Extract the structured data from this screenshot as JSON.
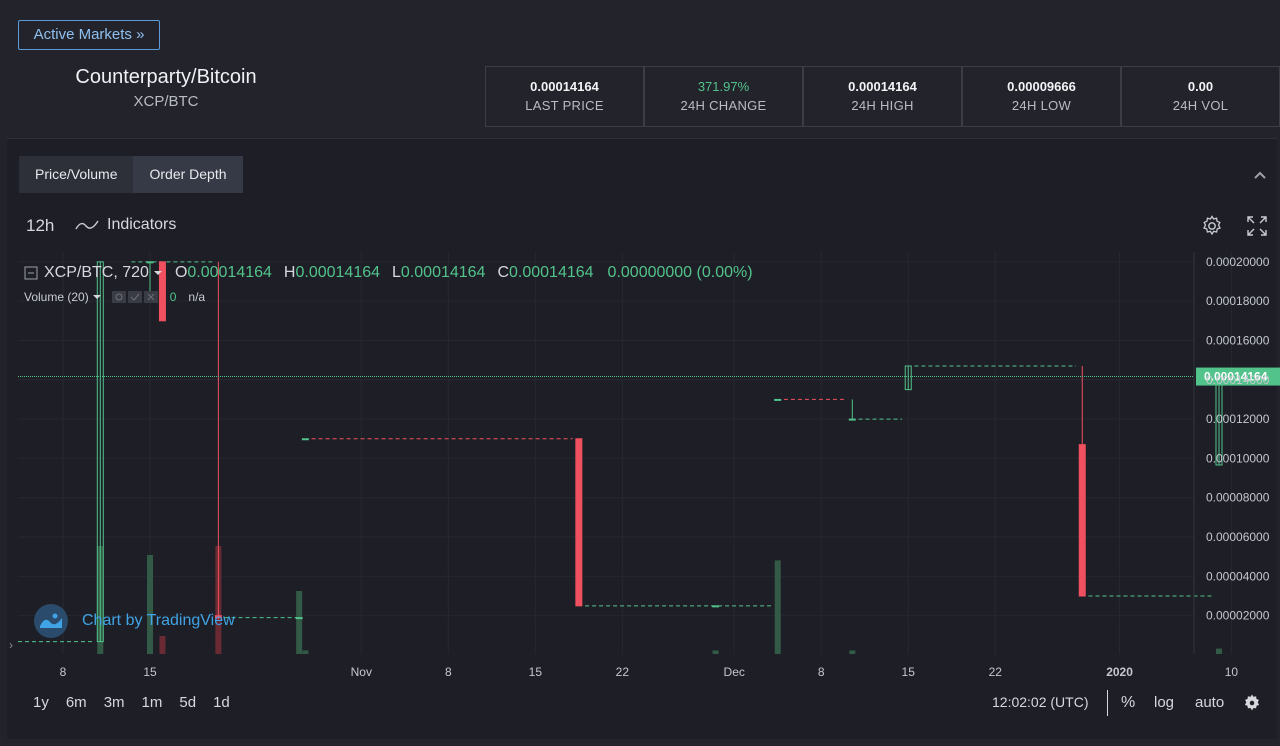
{
  "header": {
    "active_markets_label": "Active Markets »",
    "pair_name": "Counterparty/Bitcoin",
    "pair_symbol": "XCP/BTC"
  },
  "stats": [
    {
      "value": "0.00014164",
      "label": "LAST PRICE"
    },
    {
      "value": "371.97%",
      "label": "24H CHANGE"
    },
    {
      "value": "0.00014164",
      "label": "24H HIGH"
    },
    {
      "value": "0.00009666",
      "label": "24H LOW"
    },
    {
      "value": "0.00",
      "label": "24H VOL"
    }
  ],
  "tabs": [
    {
      "label": "Price/Volume"
    },
    {
      "label": "Order Depth"
    }
  ],
  "toolbar": {
    "interval": "12h",
    "indicators_label": "Indicators"
  },
  "legend": {
    "symbol": "XCP/BTC, 720",
    "o_label": "O",
    "o_value": "0.00014164",
    "h_label": "H",
    "h_value": "0.00014164",
    "l_label": "L",
    "l_value": "0.00014164",
    "c_label": "C",
    "c_value": "0.00014164",
    "change": "0.00000000 (0.00%)",
    "volume_label": "Volume (20)",
    "volume_value": "0",
    "volume_na": "n/a"
  },
  "watermark": "Chart by TradingView",
  "bottom": {
    "ranges": [
      "1y",
      "6m",
      "3m",
      "1m",
      "5d",
      "1d"
    ],
    "time": "12:02:02 (UTC)",
    "percent": "%",
    "log": "log",
    "auto": "auto"
  },
  "colors": {
    "up": "#52c38b",
    "down": "#f0505f",
    "up_volume": "#335a46",
    "down_volume": "#6a2a33"
  },
  "chart_data": {
    "type": "candlestick",
    "y_ticks": [
      "0.00020000",
      "0.00018000",
      "0.00016000",
      "0.00014000",
      "0.00012000",
      "0.00010000",
      "0.00008000",
      "0.00006000",
      "0.00004000",
      "0.00002000"
    ],
    "ylim": [
      5e-07,
      0.000205
    ],
    "x_ticks": [
      {
        "label": "8",
        "day": 8
      },
      {
        "label": "15",
        "day": 15
      },
      {
        "label": "Nov",
        "day": 32
      },
      {
        "label": "8",
        "day": 39
      },
      {
        "label": "15",
        "day": 46
      },
      {
        "label": "22",
        "day": 53
      },
      {
        "label": "Dec",
        "day": 62
      },
      {
        "label": "8",
        "day": 69
      },
      {
        "label": "15",
        "day": 76
      },
      {
        "label": "22",
        "day": 83
      },
      {
        "label": "2020",
        "day": 93
      },
      {
        "label": "10",
        "day": 102
      }
    ],
    "last_price": 0.00014164,
    "last_price_label": "0.00014164",
    "candles": [
      {
        "day": 11.0,
        "open": 6.8e-06,
        "close": 0.0002,
        "high": 0.0002,
        "low": 6.8e-06,
        "volume": 0.6
      },
      {
        "day": 15.0,
        "open": 0.0002,
        "close": 0.0002,
        "high": 0.0002,
        "low": 0.00018,
        "volume": 0.55
      },
      {
        "day": 16.0,
        "open": 0.0002,
        "close": 0.00017,
        "high": 0.0002,
        "low": 0.00017,
        "volume": 0.1
      },
      {
        "day": 20.5,
        "open": 2e-05,
        "close": 1.9e-05,
        "high": 0.0002,
        "low": 1.8e-05,
        "volume": 0.6
      },
      {
        "day": 27.0,
        "open": 1.9e-05,
        "close": 1.9e-05,
        "high": 1.9e-05,
        "low": 1.9e-05,
        "volume": 0.35
      },
      {
        "day": 27.5,
        "open": 0.00011,
        "close": 0.00011,
        "high": 0.00011,
        "low": 0.00011,
        "volume": 0.02
      },
      {
        "day": 49.5,
        "open": 0.00011,
        "close": 2.5e-05,
        "high": 0.00011,
        "low": 2.5e-05,
        "volume": 0.0
      },
      {
        "day": 60.5,
        "open": 2.5e-05,
        "close": 2.5e-05,
        "high": 2.5e-05,
        "low": 2.5e-05,
        "volume": 0.02
      },
      {
        "day": 65.5,
        "open": 0.00013,
        "close": 0.00013,
        "high": 0.00013,
        "low": 0.00013,
        "volume": 0.52
      },
      {
        "day": 71.5,
        "open": 0.00012,
        "close": 0.00012,
        "high": 0.00013,
        "low": 0.00012,
        "volume": 0.02
      },
      {
        "day": 76.0,
        "open": 0.000135,
        "close": 0.000147,
        "high": 0.000147,
        "low": 0.000135,
        "volume": 0.0
      },
      {
        "day": 90.0,
        "open": 0.000107,
        "close": 3e-05,
        "high": 0.000147,
        "low": 3e-05,
        "volume": 0.0
      },
      {
        "day": 101.0,
        "open": 9.666e-05,
        "close": 0.00014164,
        "high": 0.00014164,
        "low": 9.666e-05,
        "volume": 0.03
      }
    ],
    "flat_segments": [
      {
        "from": 0,
        "to": 10.5,
        "price": 6.8e-06,
        "dir": "up"
      },
      {
        "from": 13.5,
        "to": 20,
        "price": 0.0002,
        "dir": "up"
      },
      {
        "from": 21,
        "to": 27,
        "price": 1.9e-05,
        "dir": "up"
      },
      {
        "from": 28,
        "to": 49,
        "price": 0.00011,
        "dir": "down"
      },
      {
        "from": 50,
        "to": 65,
        "price": 2.5e-05,
        "dir": "up"
      },
      {
        "from": 66,
        "to": 71,
        "price": 0.00013,
        "dir": "down"
      },
      {
        "from": 72,
        "to": 75.5,
        "price": 0.00012,
        "dir": "up"
      },
      {
        "from": 76.5,
        "to": 89.5,
        "price": 0.000147,
        "dir": "up"
      },
      {
        "from": 90.5,
        "to": 100.5,
        "price": 3e-05,
        "dir": "up"
      }
    ]
  }
}
